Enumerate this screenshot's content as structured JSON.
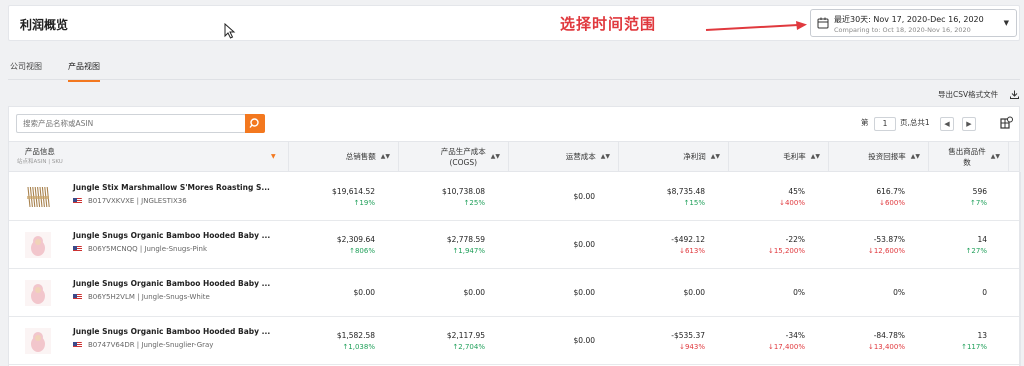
{
  "header": {
    "title": "利润概览",
    "annotation": "选择时间范围",
    "date_range": "最近30天: Nov 17, 2020-Dec 16, 2020",
    "comparing": "Comparing to: Oct 18, 2020-Nov 16, 2020"
  },
  "tabs": [
    {
      "label": "公司视图",
      "active": false
    },
    {
      "label": "产品视图",
      "active": true
    }
  ],
  "toolbar": {
    "export_label": "导出CSV格式文件",
    "search_placeholder": "搜索产品名称或ASIN",
    "page_prefix": "第",
    "page_value": "1",
    "page_total": "页,总共1"
  },
  "columns": {
    "product": "产品信息",
    "product_sub": "站点和ASIN | SKU",
    "sales": "总销售额",
    "cogs_1": "产品生产成本",
    "cogs_2": "(COGS)",
    "ops": "运营成本",
    "net": "净利润",
    "margin": "毛利率",
    "roi": "投资回报率",
    "units_1": "售出商品件",
    "units_2": "数"
  },
  "rows": [
    {
      "name": "Jungle Stix Marshmallow S'Mores Roasting S...",
      "sub": "B017VXKVXE | JNGLESTIX36",
      "thumb": "sticks",
      "sales": "$19,614.52",
      "sales_ch": "↑19%",
      "sales_dir": "up",
      "cogs": "$10,738.08",
      "cogs_ch": "↑25%",
      "cogs_dir": "up",
      "ops": "$0.00",
      "net": "$8,735.48",
      "net_ch": "↑15%",
      "net_dir": "up",
      "margin": "45%",
      "margin_ch": "↓400%",
      "margin_dir": "down",
      "roi": "616.7%",
      "roi_ch": "↓600%",
      "roi_dir": "down",
      "units": "596",
      "units_ch": "↑7%",
      "units_dir": "up"
    },
    {
      "name": "Jungle Snugs Organic Bamboo Hooded Baby ...",
      "sub": "B06Y5MCNQQ | Jungle-Snugs-Pink",
      "thumb": "baby",
      "sales": "$2,309.64",
      "sales_ch": "↑806%",
      "sales_dir": "up",
      "cogs": "$2,778.59",
      "cogs_ch": "↑1,947%",
      "cogs_dir": "up",
      "ops": "$0.00",
      "net": "-$492.12",
      "net_ch": "↓613%",
      "net_dir": "down",
      "margin": "-22%",
      "margin_ch": "↓15,200%",
      "margin_dir": "down",
      "roi": "-53.87%",
      "roi_ch": "↓12,600%",
      "roi_dir": "down",
      "units": "14",
      "units_ch": "↑27%",
      "units_dir": "up"
    },
    {
      "name": "Jungle Snugs Organic Bamboo Hooded Baby ...",
      "sub": "B06Y5H2VLM | Jungle-Snugs-White",
      "thumb": "baby",
      "sales": "$0.00",
      "sales_ch": "",
      "sales_dir": "",
      "cogs": "$0.00",
      "cogs_ch": "",
      "cogs_dir": "",
      "ops": "$0.00",
      "net": "$0.00",
      "net_ch": "",
      "net_dir": "",
      "margin": "0%",
      "margin_ch": "",
      "margin_dir": "",
      "roi": "0%",
      "roi_ch": "",
      "roi_dir": "",
      "units": "0",
      "units_ch": "",
      "units_dir": ""
    },
    {
      "name": "Jungle Snugs Organic Bamboo Hooded Baby ...",
      "sub": "B0747V64DR | Jungle-Snuglier-Gray",
      "thumb": "baby",
      "sales": "$1,582.58",
      "sales_ch": "↑1,038%",
      "sales_dir": "up",
      "cogs": "$2,117.95",
      "cogs_ch": "↑2,704%",
      "cogs_dir": "up",
      "ops": "$0.00",
      "net": "-$535.37",
      "net_ch": "↓943%",
      "net_dir": "down",
      "margin": "-34%",
      "margin_ch": "↓17,400%",
      "margin_dir": "down",
      "roi": "-84.78%",
      "roi_ch": "↓13,400%",
      "roi_dir": "down",
      "units": "13",
      "units_ch": "↑117%",
      "units_dir": "up"
    }
  ]
}
